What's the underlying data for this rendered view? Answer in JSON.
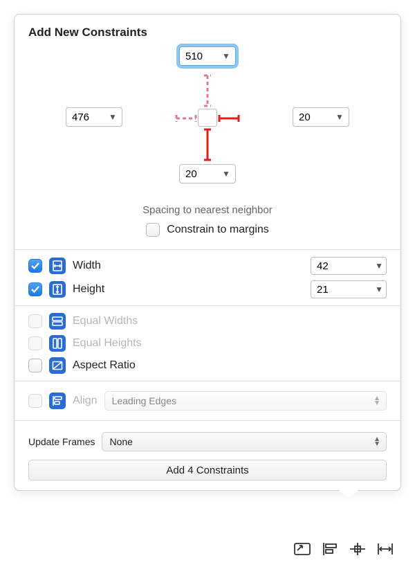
{
  "title": "Add New Constraints",
  "spacing": {
    "top": "510",
    "left": "476",
    "right": "20",
    "bottom": "20",
    "struts": {
      "top": false,
      "left": false,
      "right": true,
      "bottom": true
    },
    "captionSpacing": "Spacing to nearest neighbor",
    "constrainMargins": {
      "checked": false,
      "label": "Constrain to margins"
    }
  },
  "size": {
    "width": {
      "checked": true,
      "label": "Width",
      "value": "42"
    },
    "height": {
      "checked": true,
      "label": "Height",
      "value": "21"
    }
  },
  "equal": {
    "widths": {
      "enabled": false,
      "label": "Equal Widths"
    },
    "heights": {
      "enabled": false,
      "label": "Equal Heights"
    },
    "aspect": {
      "enabled": true,
      "checked": false,
      "label": "Aspect Ratio"
    }
  },
  "align": {
    "enabled": false,
    "label": "Align",
    "selected": "Leading Edges"
  },
  "updateFrames": {
    "label": "Update Frames",
    "selected": "None"
  },
  "action": "Add 4 Constraints",
  "toolbar": [
    "update-frames-icon",
    "align-icon",
    "pin-icon",
    "resolve-icon"
  ]
}
